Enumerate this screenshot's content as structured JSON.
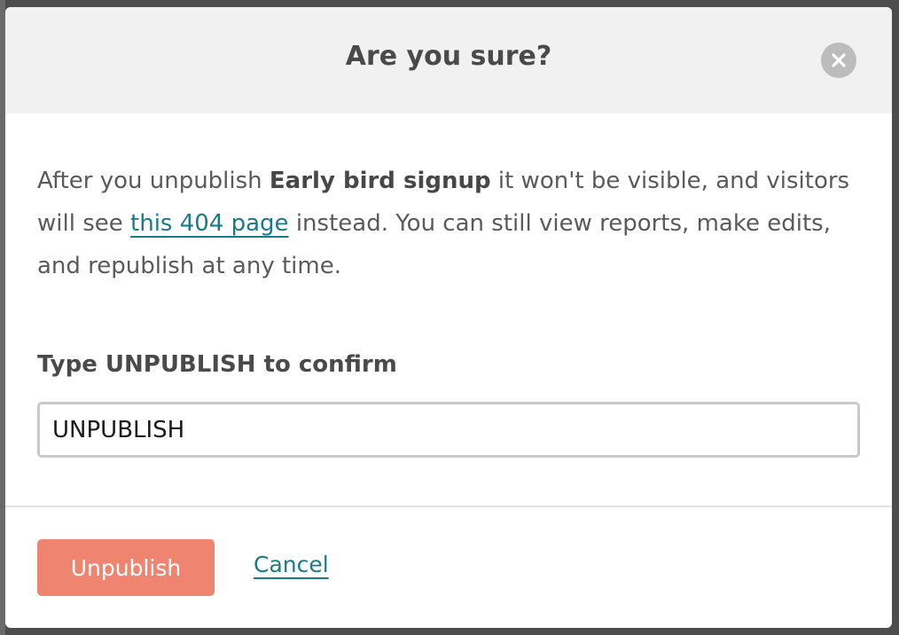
{
  "modal": {
    "title": "Are you sure?",
    "message": {
      "prefix": "After you unpublish ",
      "page_name": "Early bird signup",
      "middle": " it won't be visible, and visitors will see ",
      "link_text": "this 404 page",
      "suffix": " instead. You can still view reports, make edits, and republish at any time."
    },
    "confirm_label": "Type UNPUBLISH to confirm",
    "confirm_input_value": "UNPUBLISH",
    "unpublish_button": "Unpublish",
    "cancel_link": "Cancel",
    "close_icon": "close-icon"
  },
  "colors": {
    "header_bg": "#f1f1f1",
    "accent_link": "#1b7a8a",
    "danger_button": "#ef8471",
    "overlay": "#4d4d4d"
  }
}
